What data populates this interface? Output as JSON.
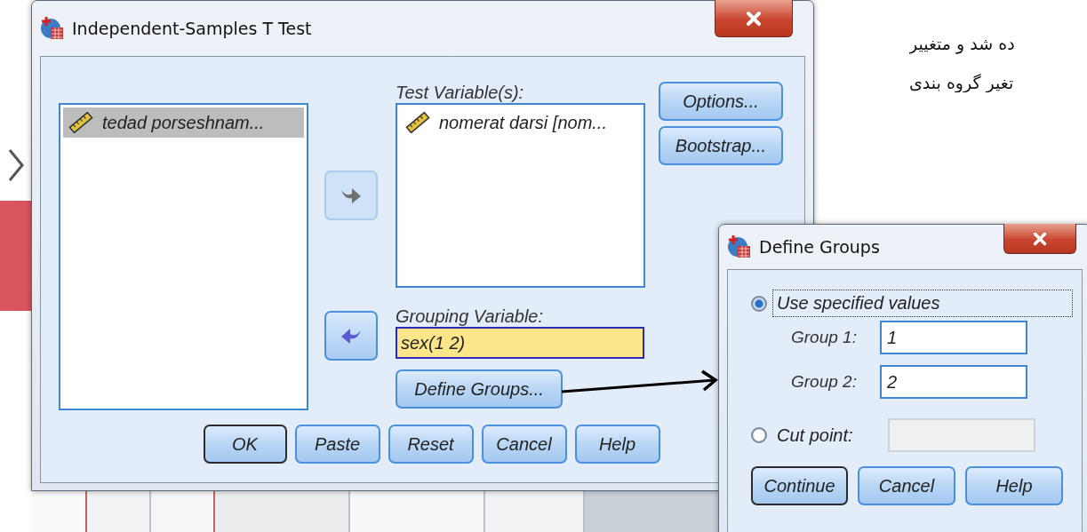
{
  "background": {
    "notes": [
      "ده شد و متغییر",
      "تغیر گروه بندی"
    ]
  },
  "main_dialog": {
    "title": "Independent-Samples T Test",
    "variables": [
      {
        "name": "tedad porseshnam...",
        "selected": true
      }
    ],
    "move_buttons": [
      {
        "kind": "right",
        "disabled": true
      },
      {
        "kind": "left",
        "disabled": false
      }
    ],
    "test_variables": {
      "label": "Test Variable(s):",
      "items": [
        {
          "name": "nomerat darsi [nom...",
          "selected": false
        }
      ]
    },
    "grouping_variable": {
      "label": "Grouping Variable:",
      "value": "sex(1 2)"
    },
    "define_groups_button": "Define Groups...",
    "side_buttons": [
      "Options...",
      "Bootstrap..."
    ],
    "buttons": [
      {
        "label": "OK",
        "default": true
      },
      {
        "label": "Paste",
        "default": false
      },
      {
        "label": "Reset",
        "default": false
      },
      {
        "label": "Cancel",
        "default": false
      },
      {
        "label": "Help",
        "default": false
      }
    ]
  },
  "define_groups": {
    "title": "Define Groups",
    "options": [
      {
        "label": "Use specified values",
        "selected": true,
        "focused": true
      },
      {
        "label": "Cut point:",
        "selected": false,
        "focused": false
      }
    ],
    "groups": [
      {
        "label": "Group 1:",
        "value": "1"
      },
      {
        "label": "Group 2:",
        "value": "2"
      }
    ],
    "cut_point": {
      "disabled": true
    },
    "buttons": [
      {
        "label": "Continue",
        "default": true
      },
      {
        "label": "Cancel",
        "default": false
      },
      {
        "label": "Help",
        "default": false
      }
    ]
  }
}
